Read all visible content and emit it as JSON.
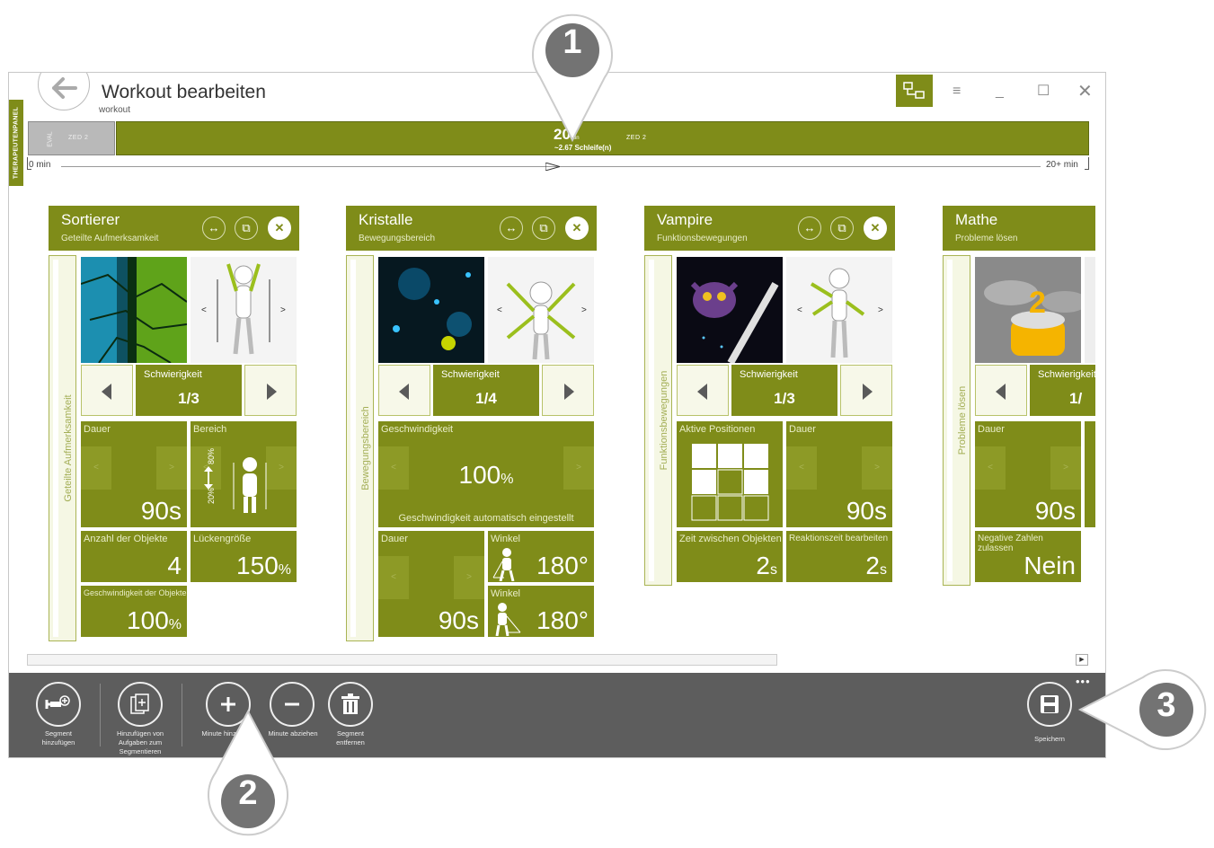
{
  "window": {
    "title": "Workout bearbeiten",
    "subtitle": "workout",
    "side_tab": "THERAPEUTENPANEL"
  },
  "timeline": {
    "eval_segment": {
      "tag": "EVAL",
      "zone": "ZED 2"
    },
    "main_segment": {
      "minutes": "20",
      "unit": "min",
      "loops": "~2.67 Schleife(n)",
      "zone": "ZED 2"
    },
    "axis_start": "0 min",
    "axis_end": "20+ min"
  },
  "cards": [
    {
      "title": "Sortierer",
      "subtitle": "Geteilte Aufmerksamkeit",
      "strip": "Geteilte Aufmerksamkeit",
      "difficulty_label": "Schwierigkeit",
      "difficulty": "1/3",
      "dauer_label": "Dauer",
      "dauer": "90s",
      "bereich_label": "Bereich",
      "bereich_high": "80%",
      "bereich_low": "20%",
      "objekte_label": "Anzahl der Objekte",
      "objekte": "4",
      "luecke_label": "Lückengröße",
      "luecke": "150",
      "luecke_unit": "%",
      "geschw_label": "Geschwindigkeit der Objekte",
      "geschw": "100",
      "geschw_unit": "%"
    },
    {
      "title": "Kristalle",
      "subtitle": "Bewegungsbereich",
      "strip": "Bewegungsbereich",
      "difficulty_label": "Schwierigkeit",
      "difficulty": "1/4",
      "geschw_label": "Geschwindigkeit",
      "geschw": "100",
      "geschw_unit": "%",
      "geschw_note": "Geschwindigkeit automatisch eingestellt",
      "dauer_label": "Dauer",
      "dauer": "90s",
      "winkel1_label": "Winkel",
      "winkel1": "180°",
      "winkel2_label": "Winkel",
      "winkel2": "180°"
    },
    {
      "title": "Vampire",
      "subtitle": "Funktionsbewegungen",
      "strip": "Funktionsbewegungen",
      "difficulty_label": "Schwierigkeit",
      "difficulty": "1/3",
      "positions_label": "Aktive Positionen",
      "dauer_label": "Dauer",
      "dauer": "90s",
      "zeit_label": "Zeit zwischen Objekten",
      "zeit": "2",
      "zeit_unit": "s",
      "reaktion_label": "Reaktionszeit bearbeiten",
      "reaktion": "2",
      "reaktion_unit": "s"
    },
    {
      "title": "Mathe",
      "subtitle": "Probleme lösen",
      "strip": "Probleme lösen",
      "difficulty_label": "Schwierigkeit",
      "difficulty": "1/",
      "dauer_label": "Dauer",
      "dauer": "90s",
      "negativ_label": "Negative Zahlen zulassen",
      "negativ": "Nein"
    }
  ],
  "toolbar": {
    "add_segment": "Segment hinzufügen",
    "add_tasks": "Hinzufügen von Aufgaben zum Segmentieren",
    "add_minute": "Minute hinzufügen",
    "remove_minute": "Minute abziehen",
    "remove_segment": "Segment entfernen",
    "save": "Speichern"
  },
  "callouts": {
    "c1": "1",
    "c2": "2",
    "c3": "3"
  },
  "colors": {
    "accent": "#7f8c19",
    "toolbar": "#5d5d5d"
  }
}
